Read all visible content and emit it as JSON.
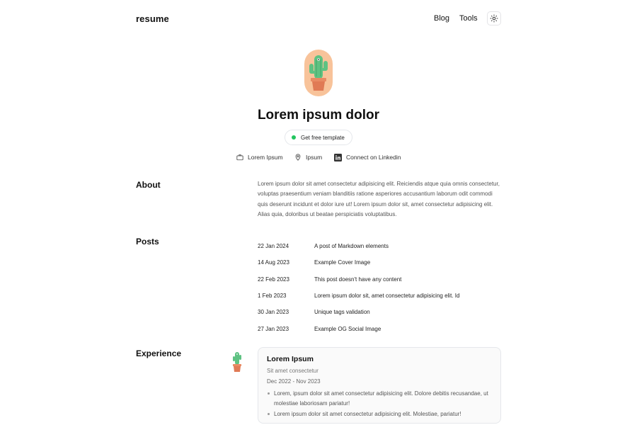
{
  "header": {
    "brand": "resume",
    "nav": [
      {
        "label": "Blog"
      },
      {
        "label": "Tools"
      }
    ],
    "theme_icon": "sun-icon"
  },
  "hero": {
    "avatar_icon": "cactus-icon",
    "title": "Lorem ipsum dolor",
    "cta_label": "Get free template",
    "meta": [
      {
        "icon": "briefcase-icon",
        "label": "Lorem Ipsum"
      },
      {
        "icon": "map-pin-icon",
        "label": "Ipsum"
      },
      {
        "icon": "linkedin-icon",
        "label": "Connect on Linkedin"
      }
    ]
  },
  "about": {
    "heading": "About",
    "text": "Lorem ipsum dolor sit amet consectetur adipisicing elit. Reiciendis atque quia omnis consectetur, voluptas praesentium veniam blanditiis ratione asperiores accusantium laborum odit commodi quis deserunt incidunt et dolor iure ut! Lorem ipsum dolor sit, amet consectetur adipisicing elit. Alias quia, doloribus ut beatae perspiciatis voluptatibus."
  },
  "posts": {
    "heading": "Posts",
    "items": [
      {
        "date": "22 Jan 2024",
        "title": "A post of Markdown elements"
      },
      {
        "date": "14 Aug 2023",
        "title": "Example Cover Image"
      },
      {
        "date": "22 Feb 2023",
        "title": "This post doesn't have any content"
      },
      {
        "date": "1 Feb 2023",
        "title": "Lorem ipsum dolor sit, amet consectetur adipisicing elit. Id"
      },
      {
        "date": "30 Jan 2023",
        "title": "Unique tags validation"
      },
      {
        "date": "27 Jan 2023",
        "title": "Example OG Social Image"
      }
    ]
  },
  "experience": {
    "heading": "Experience",
    "items": [
      {
        "company": "Lorem Ipsum",
        "role": "Sit amet consectetur",
        "dates": "Dec 2022 - Nov 2023",
        "bullets": [
          "Lorem, ipsum dolor sit amet consectetur adipisicing elit. Dolore debitis recusandae, ut molestiae laboriosam pariatur!",
          "Lorem ipsum dolor sit amet consectetur adipisicing elit. Molestiae, pariatur!"
        ]
      }
    ]
  },
  "colors": {
    "accent_dot": "#22c55e",
    "avatar_bg": "#f8c39a",
    "cactus": "#5ec282",
    "pot": "#e07a55"
  }
}
